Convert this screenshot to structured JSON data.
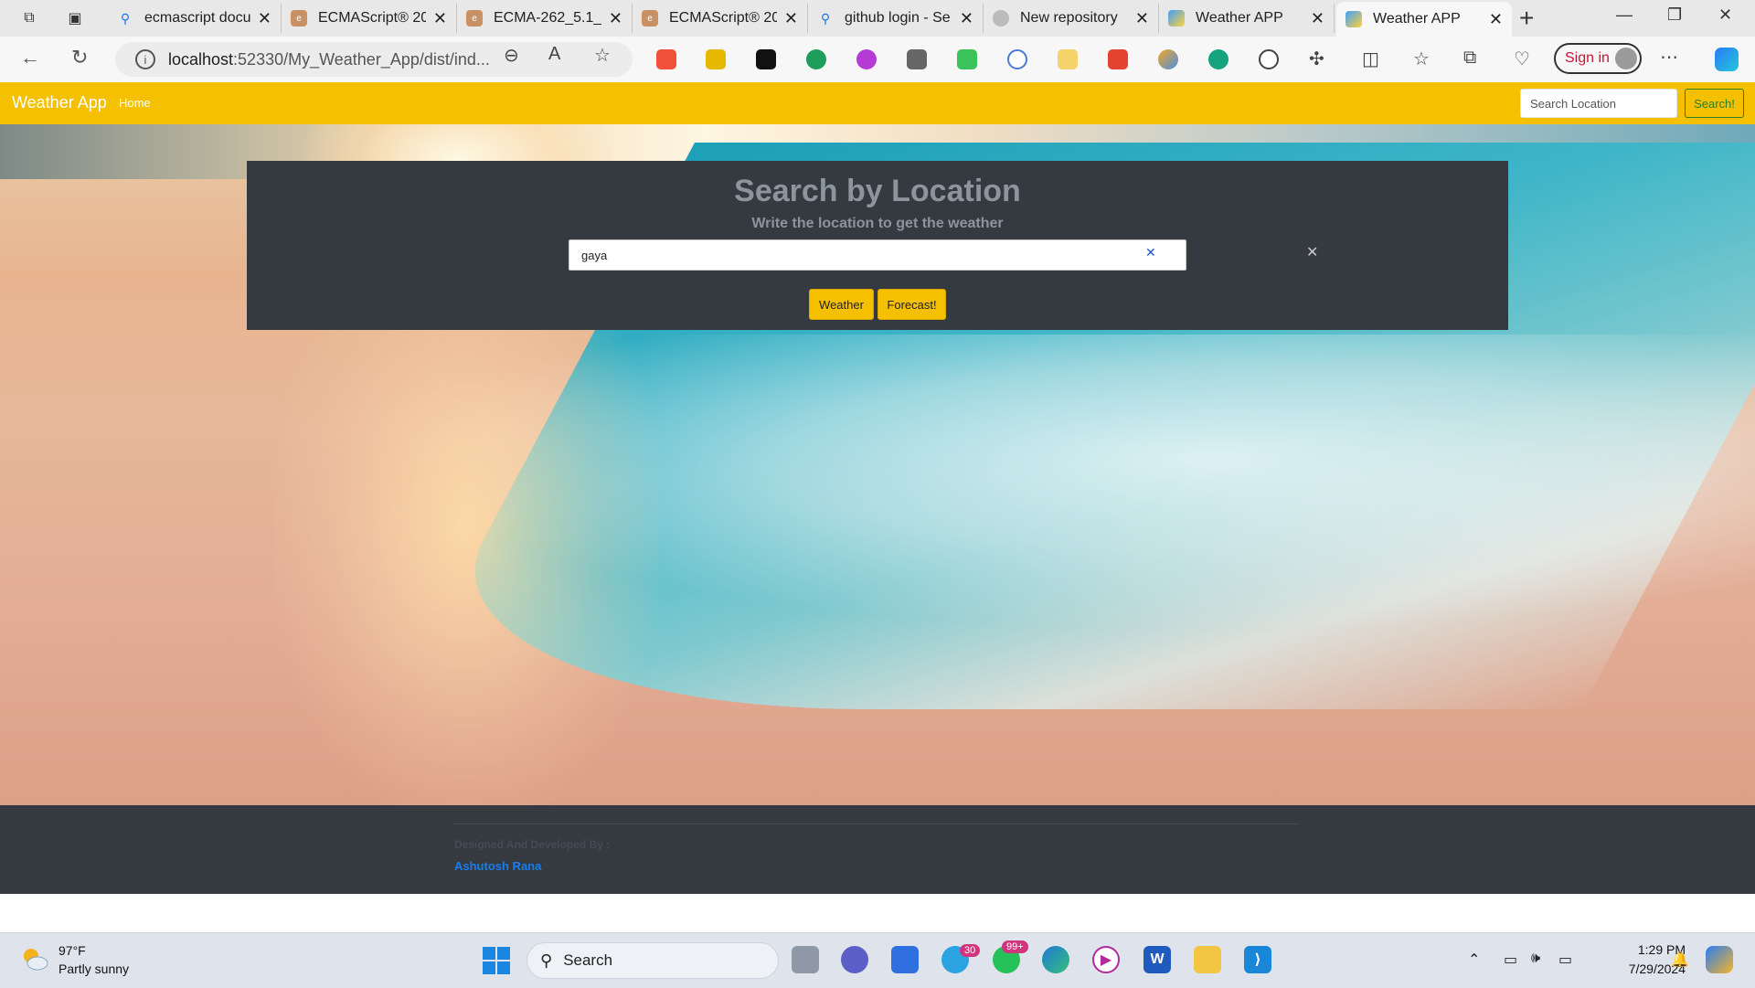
{
  "browser": {
    "tabs": [
      {
        "title": "ecmascript docu",
        "icon": "search-icon",
        "active": false
      },
      {
        "title": "ECMAScript® 20",
        "icon": "ecma-icon",
        "active": false
      },
      {
        "title": "ECMA-262_5.1_e",
        "icon": "ecma-icon",
        "active": false
      },
      {
        "title": "ECMAScript® 20",
        "icon": "ecma-icon",
        "active": false
      },
      {
        "title": "github login - Se",
        "icon": "search-icon",
        "active": false
      },
      {
        "title": "New repository",
        "icon": "github-icon",
        "active": false
      },
      {
        "title": "Weather APP",
        "icon": "weather-icon",
        "active": false
      },
      {
        "title": "Weather APP",
        "icon": "weather-icon",
        "active": true
      }
    ],
    "url_host": "localhost",
    "url_rest": ":52330/My_Weather_App/dist/ind...",
    "sign_in_label": "Sign in"
  },
  "navbar": {
    "brand": "Weather App",
    "home_link": "Home",
    "search_placeholder": "Search Location",
    "search_button": "Search!",
    "color": "#f5c000"
  },
  "panel": {
    "title": "Search by Location",
    "subtitle": "Write the location to get the weather",
    "input_value": "gaya",
    "weather_button": "Weather",
    "forecast_button": "Forecast!"
  },
  "footer": {
    "credit_label": "Designed And Developed By :",
    "author": "Ashutosh Rana"
  },
  "taskbar": {
    "temperature": "97°F",
    "condition": "Partly sunny",
    "search_label": "Search",
    "telegram_badge": "30",
    "whatsapp_badge": "99+",
    "time": "1:29 PM",
    "date": "7/29/2024"
  }
}
